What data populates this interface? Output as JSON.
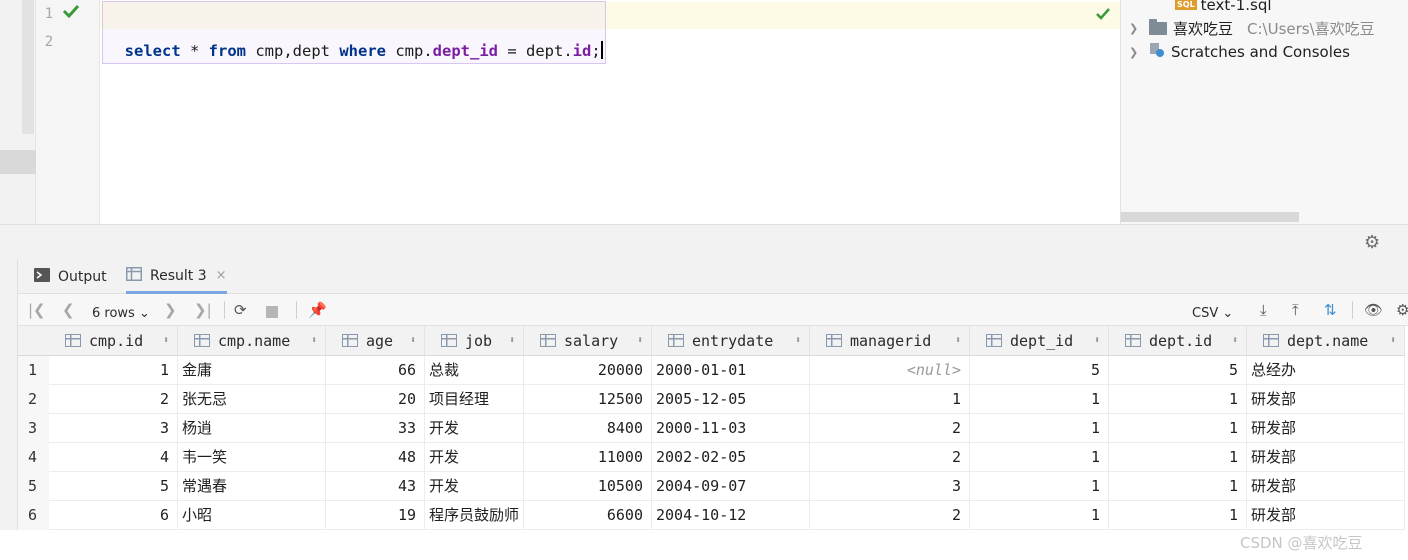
{
  "editor": {
    "line_numbers": [
      "1",
      "2"
    ],
    "sql_tokens": [
      {
        "t": "select",
        "c": "kw"
      },
      {
        "t": " * ",
        "c": "txt"
      },
      {
        "t": "from",
        "c": "kw"
      },
      {
        "t": " cmp,dept ",
        "c": "txt"
      },
      {
        "t": "where",
        "c": "kw"
      },
      {
        "t": " cmp.",
        "c": "txt"
      },
      {
        "t": "dept_id",
        "c": "fld"
      },
      {
        "t": " = dept.",
        "c": "txt"
      },
      {
        "t": "id",
        "c": "fld"
      },
      {
        "t": ";",
        "c": "txt"
      }
    ]
  },
  "project_tree": {
    "file_name": "text-1.sql",
    "file_badge": "SQL",
    "folder_name": "喜欢吃豆",
    "folder_path": "C:\\Users\\喜欢吃豆",
    "scratches_label": "Scratches and Consoles"
  },
  "tabs": [
    {
      "label": "Output"
    },
    {
      "label": "Result 3",
      "close": "×"
    }
  ],
  "toolbar": {
    "rows_label": "6 rows",
    "export_format": "CSV"
  },
  "grid": {
    "columns": [
      "cmp.id",
      "cmp.name",
      "age",
      "job",
      "salary",
      "entrydate",
      "managerid",
      "dept_id",
      "dept.id",
      "dept.name"
    ],
    "rows": [
      [
        "1",
        "金庸",
        "66",
        "总裁",
        "20000",
        "2000-01-01",
        "<null>",
        "5",
        "5",
        "总经办"
      ],
      [
        "2",
        "张无忌",
        "20",
        "项目经理",
        "12500",
        "2005-12-05",
        "1",
        "1",
        "1",
        "研发部"
      ],
      [
        "3",
        "杨逍",
        "33",
        "开发",
        "8400",
        "2000-11-03",
        "2",
        "1",
        "1",
        "研发部"
      ],
      [
        "4",
        "韦一笑",
        "48",
        "开发",
        "11000",
        "2002-02-05",
        "2",
        "1",
        "1",
        "研发部"
      ],
      [
        "5",
        "常遇春",
        "43",
        "开发",
        "10500",
        "2004-09-07",
        "3",
        "1",
        "1",
        "研发部"
      ],
      [
        "6",
        "小昭",
        "19",
        "程序员鼓励师",
        "6600",
        "2004-10-12",
        "2",
        "1",
        "1",
        "研发部"
      ]
    ]
  },
  "watermark": "CSDN @喜欢吃豆",
  "colors": {
    "accent": "#7aa7e0",
    "check_green": "#3a9a3a",
    "keyword": "#00338a",
    "field": "#7a1fa3"
  }
}
